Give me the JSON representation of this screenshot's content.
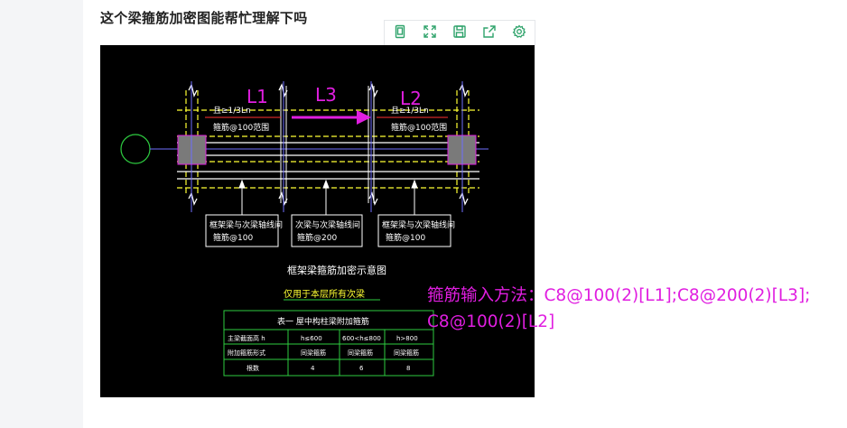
{
  "post": {
    "title": "这个梁箍筋加密图能帮忙理解下吗"
  },
  "toolbar": {
    "buttons": [
      {
        "name": "fit-page-button",
        "icon": "page-icon"
      },
      {
        "name": "fullscreen-button",
        "icon": "expand-icon"
      },
      {
        "name": "save-button",
        "icon": "floppy-icon"
      },
      {
        "name": "share-button",
        "icon": "share-icon"
      },
      {
        "name": "settings-button",
        "icon": "gear-icon"
      }
    ],
    "icon_color": "#2fa36b"
  },
  "drawing": {
    "labels": {
      "l1": "L1",
      "l3": "L3",
      "l2": "L2"
    },
    "zone_left_top": "且≥1/3Ln",
    "zone_left_bottom": "箍筋@100范围",
    "zone_right_top": "且≥1/3Ln",
    "zone_right_bottom": "箍筋@100范围",
    "box1_line1": "框架梁与次梁轴线间",
    "box1_line2": "箍筋@100",
    "box2_line1": "次梁与次梁轴线间",
    "box2_line2": "箍筋@200",
    "box3_line1": "框架梁与次梁轴线间",
    "box3_line2": "箍筋@100",
    "caption": "框架梁箍筋加密示意图",
    "subcaption": "仅用于本层所有次梁",
    "table": {
      "title": "表一  屋中构柱梁附加箍筋",
      "rows": [
        [
          "主梁截面高 h",
          "h≤600",
          "600<h≤800",
          "h>800"
        ],
        [
          "附加箍筋形式",
          "同梁箍筋",
          "同梁箍筋",
          "同梁箍筋"
        ],
        [
          "根数",
          "4",
          "6",
          "8"
        ]
      ]
    },
    "colors": {
      "background": "#000000",
      "magenta": "#e01ee0",
      "yellow": "#ffff33",
      "white": "#ffffff",
      "green": "#2ecc40",
      "blue": "#6f6fff",
      "column_fill": "#7a7a7a",
      "dim_red": "#ff3030"
    }
  },
  "note": {
    "line1": "箍筋输入方法：C8@100(2)[L1];C8@200(2)[L3];",
    "line2": "C8@100(2)[L2]"
  }
}
